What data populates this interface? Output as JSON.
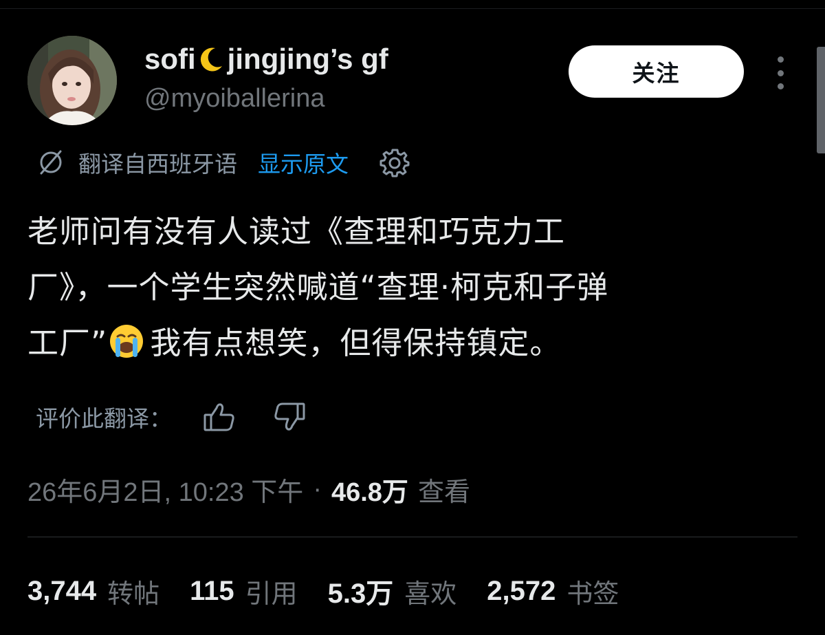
{
  "author": {
    "display_name_part1": "sofi",
    "display_name_part2": "jingjing’s gf",
    "handle": "@myoiballerina"
  },
  "actions": {
    "follow_label": "关注"
  },
  "translation": {
    "translated_from": "翻译自西班牙语",
    "show_original": "显示原文"
  },
  "tweet": {
    "lines": [
      "老师问有没有人读过《查理和巧克力工",
      "厂》，一个学生突然喊道“查理·柯克和子弹",
      "工厂”",
      "我有点想笑，但得保持镇定。"
    ]
  },
  "rating": {
    "label": "评价此翻译："
  },
  "meta": {
    "timestamp": "26年6月2日, 10:23 下午",
    "separator": "·",
    "views_count": "46.8万",
    "views_label": "查看"
  },
  "stats": [
    {
      "num": "3,744",
      "label": "转帖"
    },
    {
      "num": "115",
      "label": "引用"
    },
    {
      "num": "5.3万",
      "label": "喜欢"
    },
    {
      "num": "2,572",
      "label": "书签"
    }
  ],
  "colors": {
    "background": "#000000",
    "text_primary": "#e7e9ea",
    "text_secondary": "#71767b",
    "link": "#1d9bf0"
  }
}
